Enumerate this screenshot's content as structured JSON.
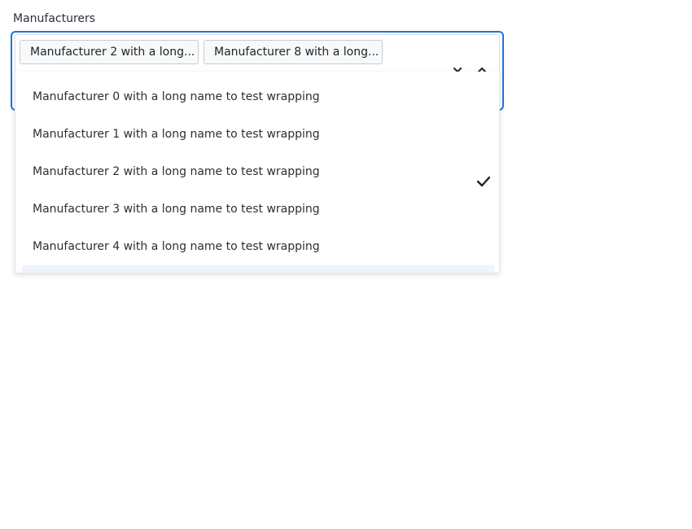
{
  "field": {
    "label": "Manufacturers"
  },
  "selected_chips": [
    {
      "label": "Manufacturer 2 with a long..."
    },
    {
      "label": "Manufacturer 8 with a long..."
    }
  ],
  "controls": {
    "clear_icon": "chevron-down-icon",
    "toggle_icon": "chevron-up-icon"
  },
  "options": [
    {
      "label": "Manufacturer 0 with a long name to test wrapping",
      "selected": false
    },
    {
      "label": "Manufacturer 1 with a long name to test wrapping",
      "selected": false
    },
    {
      "label": "Manufacturer 2 with a long name to test wrapping",
      "selected": true
    },
    {
      "label": "Manufacturer 3 with a long name to test wrapping",
      "selected": false
    },
    {
      "label": "Manufacturer 4 with a long name to test wrapping",
      "selected": false
    },
    {
      "label": "",
      "selected": false
    }
  ],
  "colors": {
    "focus_border": "#1a73e8",
    "hover_background": "#eef4fd",
    "check": "#1f2328"
  }
}
